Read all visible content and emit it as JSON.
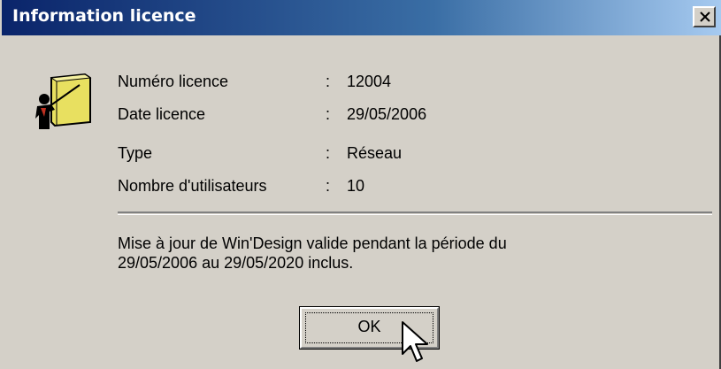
{
  "window": {
    "title": "Information licence",
    "close_symbol": "×"
  },
  "icon": {
    "name": "presenter-board-icon"
  },
  "fields": [
    {
      "label": "Numéro licence",
      "colon": ":",
      "value": "12004"
    },
    {
      "label": "Date licence",
      "colon": ":",
      "value": "29/05/2006"
    },
    {
      "label": "Type",
      "colon": ":",
      "value": "Réseau"
    },
    {
      "label": "Nombre d'utilisateurs",
      "colon": ":",
      "value": "10"
    }
  ],
  "message": {
    "line1": "Mise à jour de Win'Design valide pendant la période du",
    "line2": "29/05/2006 au 29/05/2020 inclus."
  },
  "buttons": {
    "ok_label": "OK"
  },
  "colors": {
    "title_gradient_start": "#0a246a",
    "title_gradient_end": "#a6caf0",
    "dialog_face": "#d4d0c8"
  }
}
